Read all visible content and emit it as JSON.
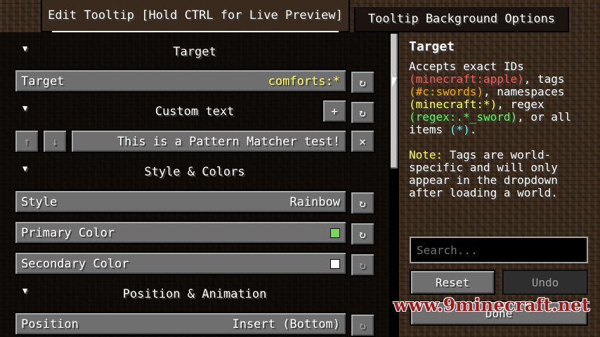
{
  "tabs": [
    {
      "label": "Edit Tooltip [Hold CTRL for Live Preview]"
    },
    {
      "label": "Tooltip Background Options"
    }
  ],
  "sections": {
    "target": {
      "header": "Target"
    },
    "custom_text": {
      "header": "Custom text"
    },
    "style_colors": {
      "header": "Style & Colors"
    },
    "position_animation": {
      "header": "Position & Animation"
    }
  },
  "fields": {
    "target": {
      "label": "Target",
      "value": "comforts:*"
    },
    "custom_text": {
      "value": "This is a Pattern Matcher test!"
    },
    "style": {
      "label": "Style",
      "value": "Rainbow"
    },
    "primary_color": {
      "label": "Primary Color",
      "swatch": "#7bd75b"
    },
    "secondary_color": {
      "label": "Secondary Color",
      "swatch": "#ffffff"
    },
    "position": {
      "label": "Position",
      "value": "Insert (Bottom)"
    }
  },
  "glyphs": {
    "reset": "↻",
    "plus": "+",
    "up": "↑",
    "down": "↓",
    "remove": "✕",
    "collapse": "▼"
  },
  "help": {
    "title": "Target",
    "p1_a": "Accepts exact IDs ",
    "p1_exact": "(minecraft:apple)",
    "p1_b": ", tags ",
    "p1_tags": "(#c:swords)",
    "p1_c": ", namespaces ",
    "p1_ns": "(minecraft:*)",
    "p1_d": ", regex ",
    "p1_regex": "(regex:.*_sword)",
    "p1_e": ", or all items ",
    "p1_all": "(*)",
    "p1_f": ".",
    "note_label": "Note:",
    "note_text": " Tags are world-specific and will only appear in the dropdown after loading a world."
  },
  "search": {
    "placeholder": "Search..."
  },
  "actions": {
    "reset": "Reset",
    "undo": "Undo",
    "done": "Done"
  },
  "watermark": "www.9minecraft.net"
}
